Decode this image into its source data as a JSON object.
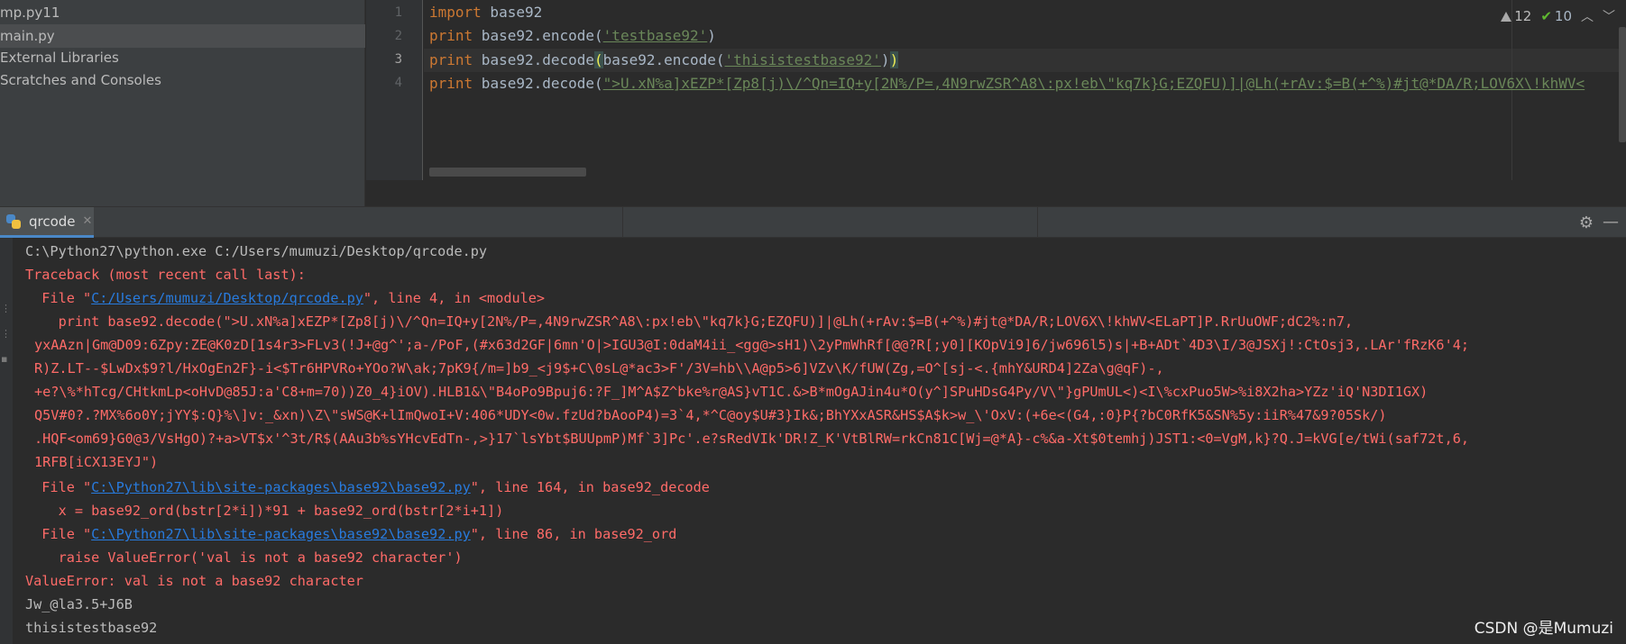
{
  "project_tree": {
    "items": [
      {
        "label": "mp.py11",
        "selected": false
      },
      {
        "label": "main.py",
        "selected": true
      },
      {
        "label": "External Libraries",
        "selected": false
      },
      {
        "label": "Scratches and Consoles",
        "selected": false
      }
    ]
  },
  "editor": {
    "line_numbers": [
      "1",
      "2",
      "3",
      "4"
    ],
    "lines": [
      {
        "kw": "import",
        "rest": " base92"
      },
      {
        "kw": "print",
        "pre": " base92.encode(",
        "str": "'testbase92'",
        "post": ")"
      },
      {
        "kw": "print",
        "pre": " base92.decode",
        "open": "(",
        "mid": "base92.encode(",
        "str": "'thisistestbase92'",
        "close_inner": ")",
        "close": ")"
      },
      {
        "kw": "print",
        "pre": " base92.decode(",
        "str": "\">U.xN%a]xEZP*[Zp8[j)\\/^Qn=IQ+y[2N%/P=,4N9rwZSR^A8\\:px!eb\\\"kq7k}G;EZQFU)]|@Lh(+rAv:$=B(+^%)#jt@*DA/R;LOV6X\\!khWV<"
      }
    ],
    "inspections": {
      "warnings": "12",
      "ok": "10"
    }
  },
  "run_panel": {
    "tab_label": "qrcode",
    "output": {
      "cmd": "C:\\Python27\\python.exe C:/Users/mumuzi/Desktop/qrcode.py",
      "traceback_header": "Traceback (most recent call last):",
      "frame1_prefix": "  File \"",
      "frame1_link": "C:/Users/mumuzi/Desktop/qrcode.py",
      "frame1_suffix": "\", line 4, in <module>",
      "code1_l1": "    print base92.decode(\">U.xN%a]xEZP*[Zp8[j)\\/^Qn=IQ+y[2N%/P=,4N9rwZSR^A8\\:px!eb\\\"kq7k}G;EZQFU)]|@Lh(+rAv:$=B(+^%)#jt@*DA/R;LOV6X\\!khWV<ELaPT]P.RrUuOWF;dC2%:n7,",
      "code1_l2": "yxAAzn|Gm@D09:6Zpy:ZE@K0zD[1s4r3>FLv3(!J+@g^';a-/PoF,(#x63d2GF|6mn'O|>IGU3@I:0daM4ii_<gg@>sH1)\\2yPmWhRf[@@?R[;y0][KOpVi9]6/jw696l5)s|+B+ADt`4D3\\I/3@JSXj!:CtOsj3,.LAr'fRzK6'4;",
      "code1_l3": "R)Z.LT--$LwDx$9?l/HxOgEn2F}-i<$Tr6HPVRo+YOo?W\\ak;7pK9{/m=]b9_<j9$+C\\0sL@*ac3>F'/3V=hb\\\\A@p5>6]VZv\\K/fUW(Zg,=O^[sj-<.{mhY&URD4]2Za\\g@qF)-,",
      "code1_l4": "+e?\\%*hTcg/CHtkmLp<oHvD@85J:a'C8+m=70))Z0_4}iOV).HLB1&\\\"B4oPo9Bpuj6:?F_]M^A$Z^bke%r@AS}vT1C.&>B*mOgAJin4u*O(y^]SPuHDsG4Py/V\\\"}gPUmUL<)<I\\%cxPuo5W>%i8X2ha>YZz'iQ'N3DI1GX)",
      "code1_l5": "Q5V#0?.?MX%6o0Y;jYY$:Q}%\\]v:_&xn)\\Z\\\"sWS@K+lImQwoI+V:406*UDY<0w.fzUd?bAooP4)=3`4,*^C@oy$U#3}Ik&;BhYXxASR&HS$A$k>w_\\'OxV:(+6e<(G4,:0}P{?bC0RfK5&SN%5y:iiR%47&9?05Sk/)",
      "code1_l6": ".HQF<om69}G0@3/VsHgO)?+a>VT$x'^3t/R$(AAu3b%sYHcvEdTn-,>}17`lsYbt$BUUpmP)Mf`3]Pc'.e?sRedVIk'DR!Z_K'VtBlRW=rkCn81C[Wj=@*A}-c%&a-Xt$0temhj)JST1:<0=VgM,k}?Q.J=kVG[e/tWi(saf72t,6,",
      "code1_l7": "1RFB[iCX13EYJ\")",
      "frame2_prefix": "  File \"",
      "frame2_link": "C:\\Python27\\lib\\site-packages\\base92\\base92.py",
      "frame2_suffix": "\", line 164, in base92_decode",
      "code2": "    x = base92_ord(bstr[2*i])*91 + base92_ord(bstr[2*i+1])",
      "frame3_prefix": "  File \"",
      "frame3_link": "C:\\Python27\\lib\\site-packages\\base92\\base92.py",
      "frame3_suffix": "\", line 86, in base92_ord",
      "code3": "    raise ValueError('val is not a base92 character')",
      "error": "ValueError: val is not a base92 character",
      "out1": "Jw_@la3.5+J6B",
      "out2": "thisistestbase92"
    }
  },
  "watermark": "CSDN @是Mumuzi",
  "colors": {
    "error": "#ff6b68",
    "link": "#287bde",
    "keyword": "#cc7832",
    "string": "#6a8759"
  }
}
